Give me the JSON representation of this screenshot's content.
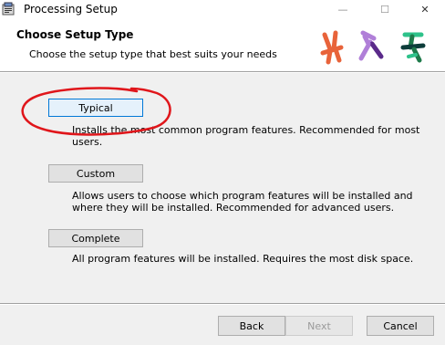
{
  "window": {
    "title": "Processing Setup",
    "icon": "installer-icon",
    "controls": [
      "minimize",
      "maximize",
      "close"
    ],
    "minimize_glyph": "—",
    "maximize_glyph": "☐",
    "close_glyph": "✕"
  },
  "header": {
    "title": "Choose Setup Type",
    "subtitle": "Choose the setup type that best suits your needs",
    "logo": "processing-logo",
    "logo_colors": [
      "#e8633a",
      "#b07fd8",
      "#1e7a4a"
    ]
  },
  "options": [
    {
      "label": "Typical",
      "description": "Installs the most common program features. Recommended for most users."
    },
    {
      "label": "Custom",
      "description": "Allows users to choose which program features will be installed and where they will be installed. Recommended for advanced users."
    },
    {
      "label": "Complete",
      "description": "All program features will be installed. Requires the most disk space."
    }
  ],
  "footer": {
    "back_label": "Back",
    "next_label": "Next",
    "cancel_label": "Cancel"
  },
  "annotation_color": "#e0161b"
}
